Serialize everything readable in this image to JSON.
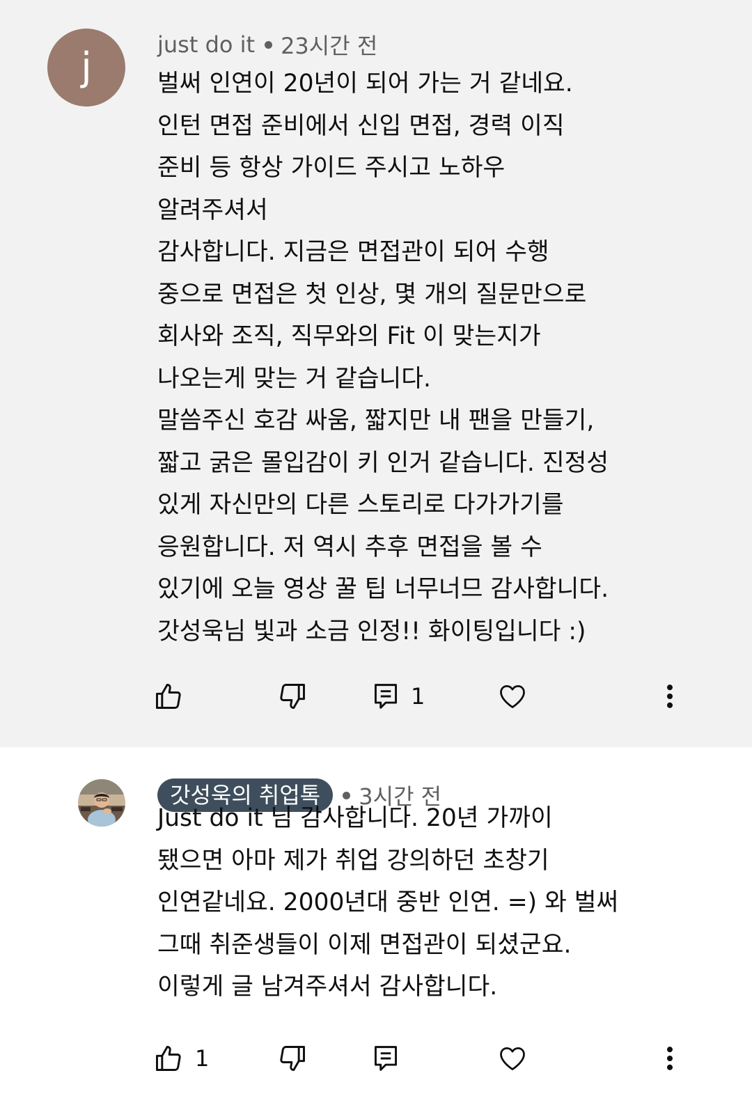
{
  "comments": [
    {
      "avatar_letter": "j",
      "avatar_color": "#9a7b6e",
      "author": "just do it",
      "time": "23시간 전",
      "lines": [
        "벌써 인연이 20년이 되어 가는 거 같네요.",
        "인턴 면접 준비에서 신입 면접, 경력 이직",
        "준비 등 항상 가이드 주시고 노하우",
        "알려주셔서",
        "감사합니다. 지금은 면접관이 되어 수행",
        "중으로 면접은 첫 인상, 몇 개의 질문만으로",
        "회사와 조직, 직무와의 Fit 이 맞는지가",
        "나오는게 맞는 거 같습니다.",
        "말씀주신 호감 싸움, 짧지만 내 팬을 만들기,",
        "짧고 굵은 몰입감이 키 인거 같습니다. 진정성",
        "있게 자신만의 다른 스토리로 다가가기를",
        "응원합니다. 저 역시 추후 면접을 볼 수",
        "있기에 오늘 영상 꿀 팁 너무너므 감사합니다.",
        "갓성욱님 빛과 소금 인정!! 화이팅입니다 :)"
      ],
      "actions": {
        "like_icon": "thumbs-up-icon",
        "like_count": "",
        "dislike_icon": "thumbs-down-icon",
        "reply_icon": "reply-icon",
        "reply_count": "1",
        "heart_icon": "heart-icon",
        "more_icon": "more-vertical-icon"
      }
    },
    {
      "avatar_image": "channel-owner-photo",
      "author": "갓성욱의 취업톡",
      "author_badge_color": "#3f4e5c",
      "time": "3시간 전",
      "lines": [
        "Just do it 님 감사합니다. 20년 가까이",
        "됐으면 아마 제가 취업 강의하던 초창기",
        "인연같네요. 2000년대 중반 인연. =) 와 벌써",
        "그때 취준생들이 이제 면접관이 되셨군요.",
        "이렇게 글 남겨주셔서 감사합니다."
      ],
      "actions": {
        "like_icon": "thumbs-up-icon",
        "like_count": "1",
        "dislike_icon": "thumbs-down-icon",
        "reply_icon": "reply-icon",
        "reply_count": "",
        "heart_icon": "heart-icon",
        "more_icon": "more-vertical-icon"
      }
    }
  ]
}
